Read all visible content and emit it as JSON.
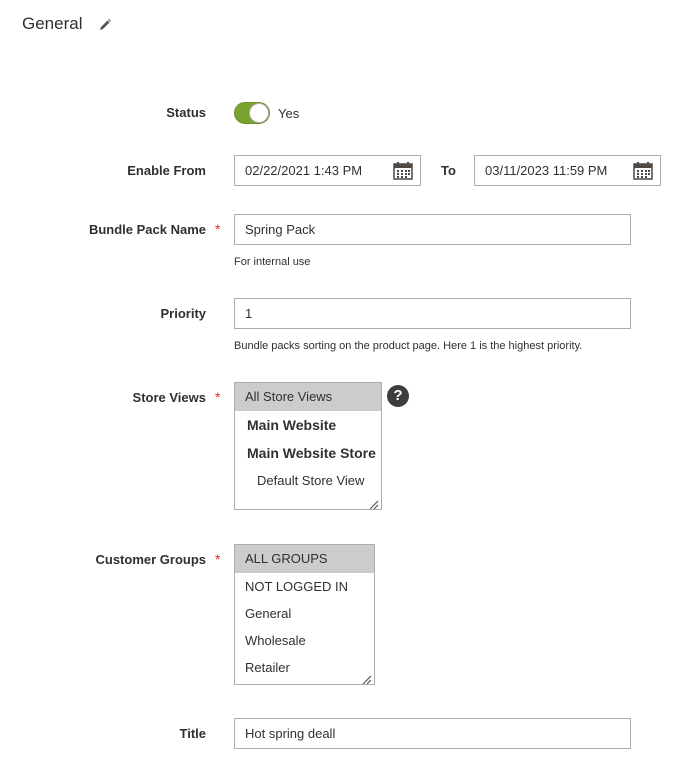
{
  "section": {
    "title": "General"
  },
  "status": {
    "label": "Status",
    "value": "Yes",
    "enabled": true,
    "accent": "#79a22e"
  },
  "enable_from": {
    "label": "Enable From",
    "from_value": "02/22/2021 1:43 PM",
    "to_label": "To",
    "to_value": "03/11/2023 11:59 PM"
  },
  "bundle_name": {
    "label": "Bundle Pack Name",
    "value": "Spring Pack",
    "note": "For internal use"
  },
  "priority": {
    "label": "Priority",
    "value": "1",
    "note": "Bundle packs sorting on the product page. Here 1 is the highest priority."
  },
  "store_views": {
    "label": "Store Views",
    "options": [
      "All Store Views",
      "Main Website",
      "Main Website Store",
      "Default Store View"
    ],
    "selected": "All Store Views",
    "help": "?"
  },
  "customer_groups": {
    "label": "Customer Groups",
    "options": [
      "ALL GROUPS",
      "NOT LOGGED IN",
      "General",
      "Wholesale",
      "Retailer"
    ],
    "selected": "ALL GROUPS"
  },
  "title": {
    "label": "Title",
    "value": "Hot spring deall"
  },
  "required_mark": "*",
  "colors": {
    "required": "#e02b27",
    "selected_option": "#cccccc",
    "border": "#adadad"
  }
}
